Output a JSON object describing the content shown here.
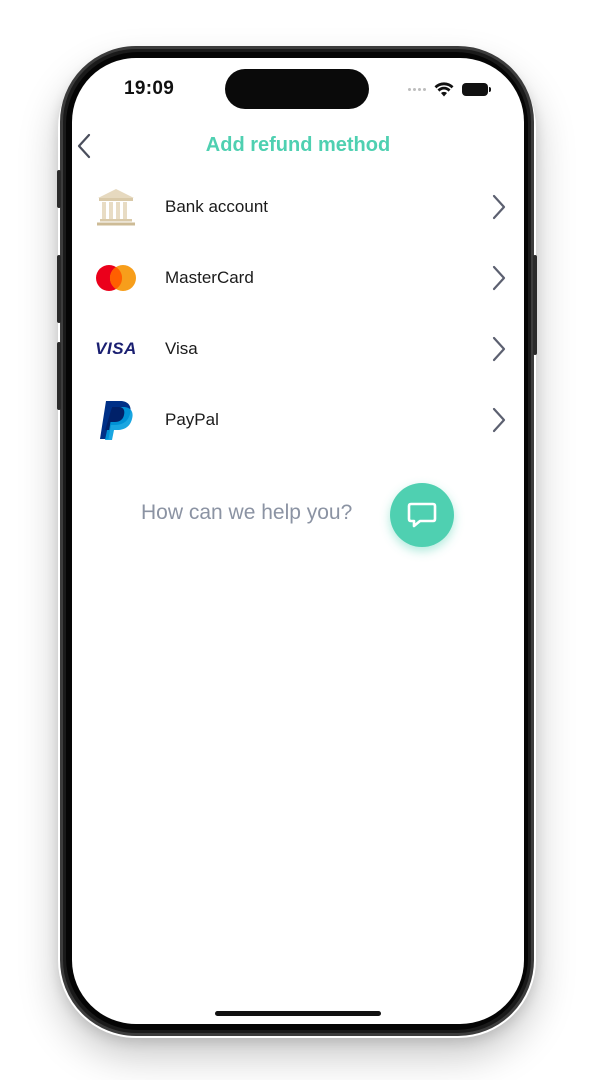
{
  "status_bar": {
    "time": "19:09",
    "wifi_icon": "wifi-icon",
    "battery_icon": "battery-icon"
  },
  "header": {
    "title": "Add refund method",
    "back_icon": "chevron-left-icon"
  },
  "refund_methods": [
    {
      "label": "Bank account",
      "icon": "bank-icon"
    },
    {
      "label": "MasterCard",
      "icon": "mastercard-icon"
    },
    {
      "label": "Visa",
      "icon": "visa-icon",
      "logo_text": "VISA"
    },
    {
      "label": "PayPal",
      "icon": "paypal-icon"
    }
  ],
  "help": {
    "text": "How can we help you?",
    "button_icon": "chat-icon"
  },
  "colors": {
    "accent": "#4fd0b1",
    "help_text": "#8b93a3",
    "chevron": "#5c6070",
    "mastercard_red": "#eb001b",
    "mastercard_orange": "#f79e1b",
    "visa_blue": "#1a1f71",
    "paypal_dark": "#003087",
    "paypal_light": "#009cde",
    "bank_beige": "#d9c9a8"
  }
}
